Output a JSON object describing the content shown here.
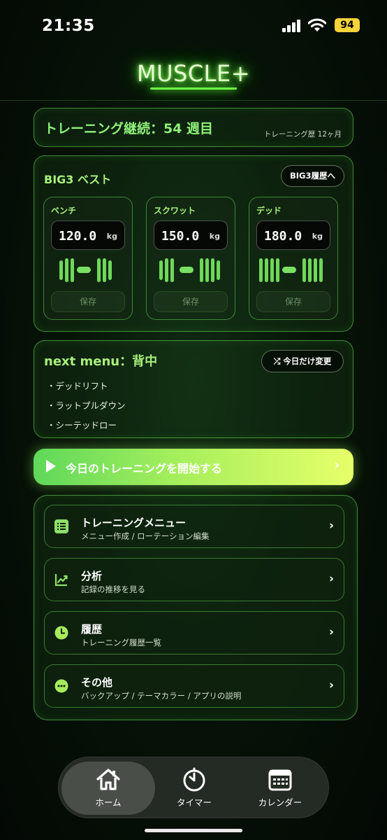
{
  "status_bar": {
    "time": "21:35",
    "battery": "94",
    "battery_color": "#f5d33a"
  },
  "app": {
    "title": "MUSCLE+",
    "accent": "#8ff07a"
  },
  "streak": {
    "text": "トレーニング継続：54 週目",
    "sub": "トレーニング歴 12ヶ月"
  },
  "big3": {
    "title": "BIG3 ベスト",
    "history_button": "BIG3履歴へ",
    "lifts": [
      {
        "name": "ベンチ",
        "value": "120.0",
        "unit": "kg",
        "save": "保存"
      },
      {
        "name": "スクワット",
        "value": "150.0",
        "unit": "kg",
        "save": "保存"
      },
      {
        "name": "デッド",
        "value": "180.0",
        "unit": "kg",
        "save": "保存"
      }
    ]
  },
  "next_menu": {
    "title": "next menu：背中",
    "change_button": "今日だけ変更",
    "change_icon": "shuffle-icon",
    "items": [
      "・デッドリフト",
      "・ラットプルダウン",
      "・シーテッドロー"
    ]
  },
  "start": {
    "label": "今日のトレーニングを開始する",
    "icon": "play-icon",
    "chevron": "›"
  },
  "menu": [
    {
      "title": "トレーニングメニュー",
      "sub": "メニュー作成 / ローテーション編集",
      "icon": "list-icon"
    },
    {
      "title": "分析",
      "sub": "記録の推移を見る",
      "icon": "chart-icon"
    },
    {
      "title": "履歴",
      "sub": "トレーニング履歴一覧",
      "icon": "clock-icon"
    },
    {
      "title": "その他",
      "sub": "バックアップ / テーマカラー / アプリの説明",
      "icon": "more-icon"
    }
  ],
  "tabs": [
    {
      "label": "ホーム",
      "icon": "home-icon",
      "active": true
    },
    {
      "label": "タイマー",
      "icon": "timer-icon",
      "active": false
    },
    {
      "label": "カレンダー",
      "icon": "calendar-icon",
      "active": false
    }
  ]
}
